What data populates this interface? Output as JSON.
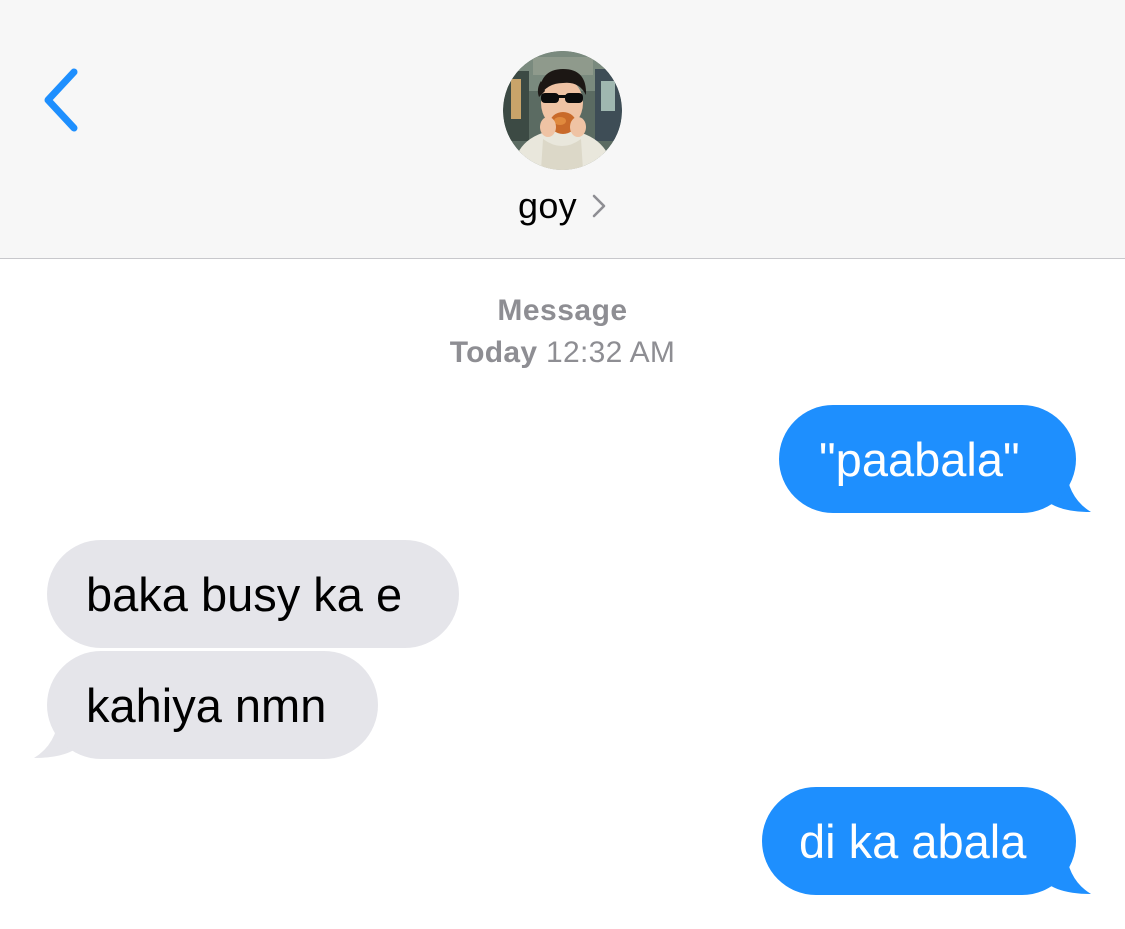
{
  "header": {
    "contact_name": "goy",
    "back_icon": "chevron-left-icon",
    "accent_color": "#1e8ffe"
  },
  "thread": {
    "service_label": "Message",
    "timestamp_day": "Today",
    "timestamp_time": "12:32 AM"
  },
  "messages": [
    {
      "direction": "sent",
      "text": "\"paabala\""
    },
    {
      "direction": "received",
      "text": "baka busy ka e"
    },
    {
      "direction": "received",
      "text": "kahiya nmn"
    },
    {
      "direction": "sent",
      "text": "di ka abala"
    }
  ],
  "colors": {
    "sent_bubble": "#1e8ffe",
    "received_bubble": "#e5e5ea",
    "header_bg": "#f7f7f7",
    "meta_text": "#8e8e93"
  }
}
